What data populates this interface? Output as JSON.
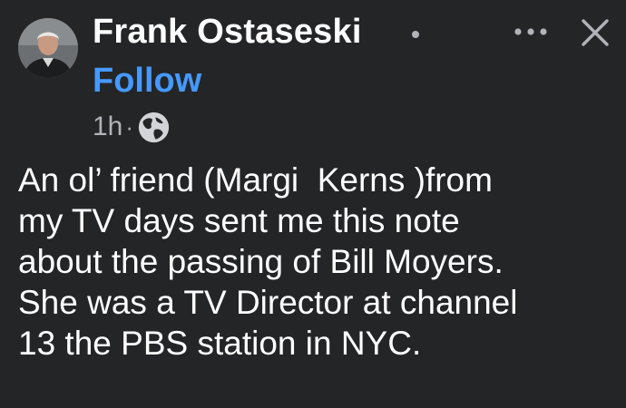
{
  "post": {
    "author": {
      "name": "Frank Ostaseski",
      "avatar_icon": "person-avatar-icon"
    },
    "follow_label": "Follow",
    "timestamp": "1h",
    "separator": "·",
    "audience_icon": "globe-icon",
    "more_icon": "more-options-icon",
    "close_icon": "close-icon",
    "body_lines": [
      "An ol’ friend (Margi  Kerns )from",
      "my TV days sent me this note",
      "about the passing of Bill Moyers.",
      "She was a TV Director at channel",
      "13 the PBS station in NYC."
    ]
  },
  "colors": {
    "background": "#242526",
    "primary_text": "#ffffff",
    "secondary_text": "#b0b3b8",
    "link": "#4599ff"
  }
}
